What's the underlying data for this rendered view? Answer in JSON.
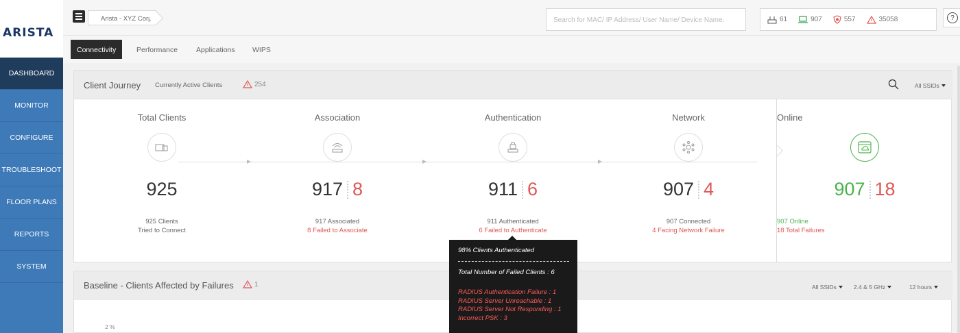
{
  "brand": {
    "logo_text": "ARISTA"
  },
  "sidebar": {
    "items": [
      {
        "label": "DASHBOARD",
        "active": true
      },
      {
        "label": "MONITOR"
      },
      {
        "label": "CONFIGURE"
      },
      {
        "label": "TROUBLESHOOT"
      },
      {
        "label": "FLOOR PLANS"
      },
      {
        "label": "REPORTS"
      },
      {
        "label": "SYSTEM"
      }
    ]
  },
  "topbar": {
    "breadcrumb": "Arista - XYZ Corp",
    "search_placeholder": "Search for MAC/ IP Address/ User Name/ Device Name.",
    "stats": [
      {
        "icon": "access-point-icon",
        "value": "61"
      },
      {
        "icon": "laptop-icon",
        "value": "907"
      },
      {
        "icon": "shield-icon",
        "value": "557"
      },
      {
        "icon": "alert-icon",
        "value": "35058"
      }
    ],
    "help_label": "?"
  },
  "tabs": [
    {
      "label": "Connectivity",
      "active": true
    },
    {
      "label": "Performance"
    },
    {
      "label": "Applications"
    },
    {
      "label": "WIPS"
    }
  ],
  "client_journey": {
    "title": "Client Journey",
    "subtitle": "Currently Active Clients",
    "alert_count": "254",
    "ssid_filter": "All SSIDs",
    "stages": [
      {
        "name": "Total Clients",
        "count": "925",
        "fail": "",
        "line1": "925 Clients",
        "line2": "Tried to Connect"
      },
      {
        "name": "Association",
        "count": "917",
        "fail": "8",
        "line1": "917 Associated",
        "line2": "8 Failed to Associate"
      },
      {
        "name": "Authentication",
        "count": "911",
        "fail": "6",
        "line1": "911 Authenticated",
        "line2": "6 Failed to Authenticate"
      },
      {
        "name": "Network",
        "count": "907",
        "fail": "4",
        "line1": "907 Connected",
        "line2": "4 Facing Network Failure"
      }
    ],
    "online": {
      "name": "Online",
      "count": "907",
      "fail": "18",
      "line1": "907 Online",
      "line2": "18 Total Failures"
    }
  },
  "baseline": {
    "title": "Baseline - Clients Affected by Failures",
    "alert_count": "1",
    "filters": [
      "All SSIDs",
      "2.4 & 5 GHz",
      "12 hours"
    ],
    "y_tick": "2 %"
  },
  "tooltip": {
    "title": "98% Clients Authenticated",
    "total": "Total Number of Failed Clients : 6",
    "failures": [
      "RADIUS Authentication Failure : 1",
      "RADIUS Server Unreachable : 1",
      "RADIUS Server Not Responding : 1",
      "Incorrect PSK : 3"
    ]
  },
  "colors": {
    "sidebar": "#3e7ab8",
    "sidebar_active": "#1f3c5c",
    "fail": "#e05757",
    "online": "#49b34b"
  }
}
